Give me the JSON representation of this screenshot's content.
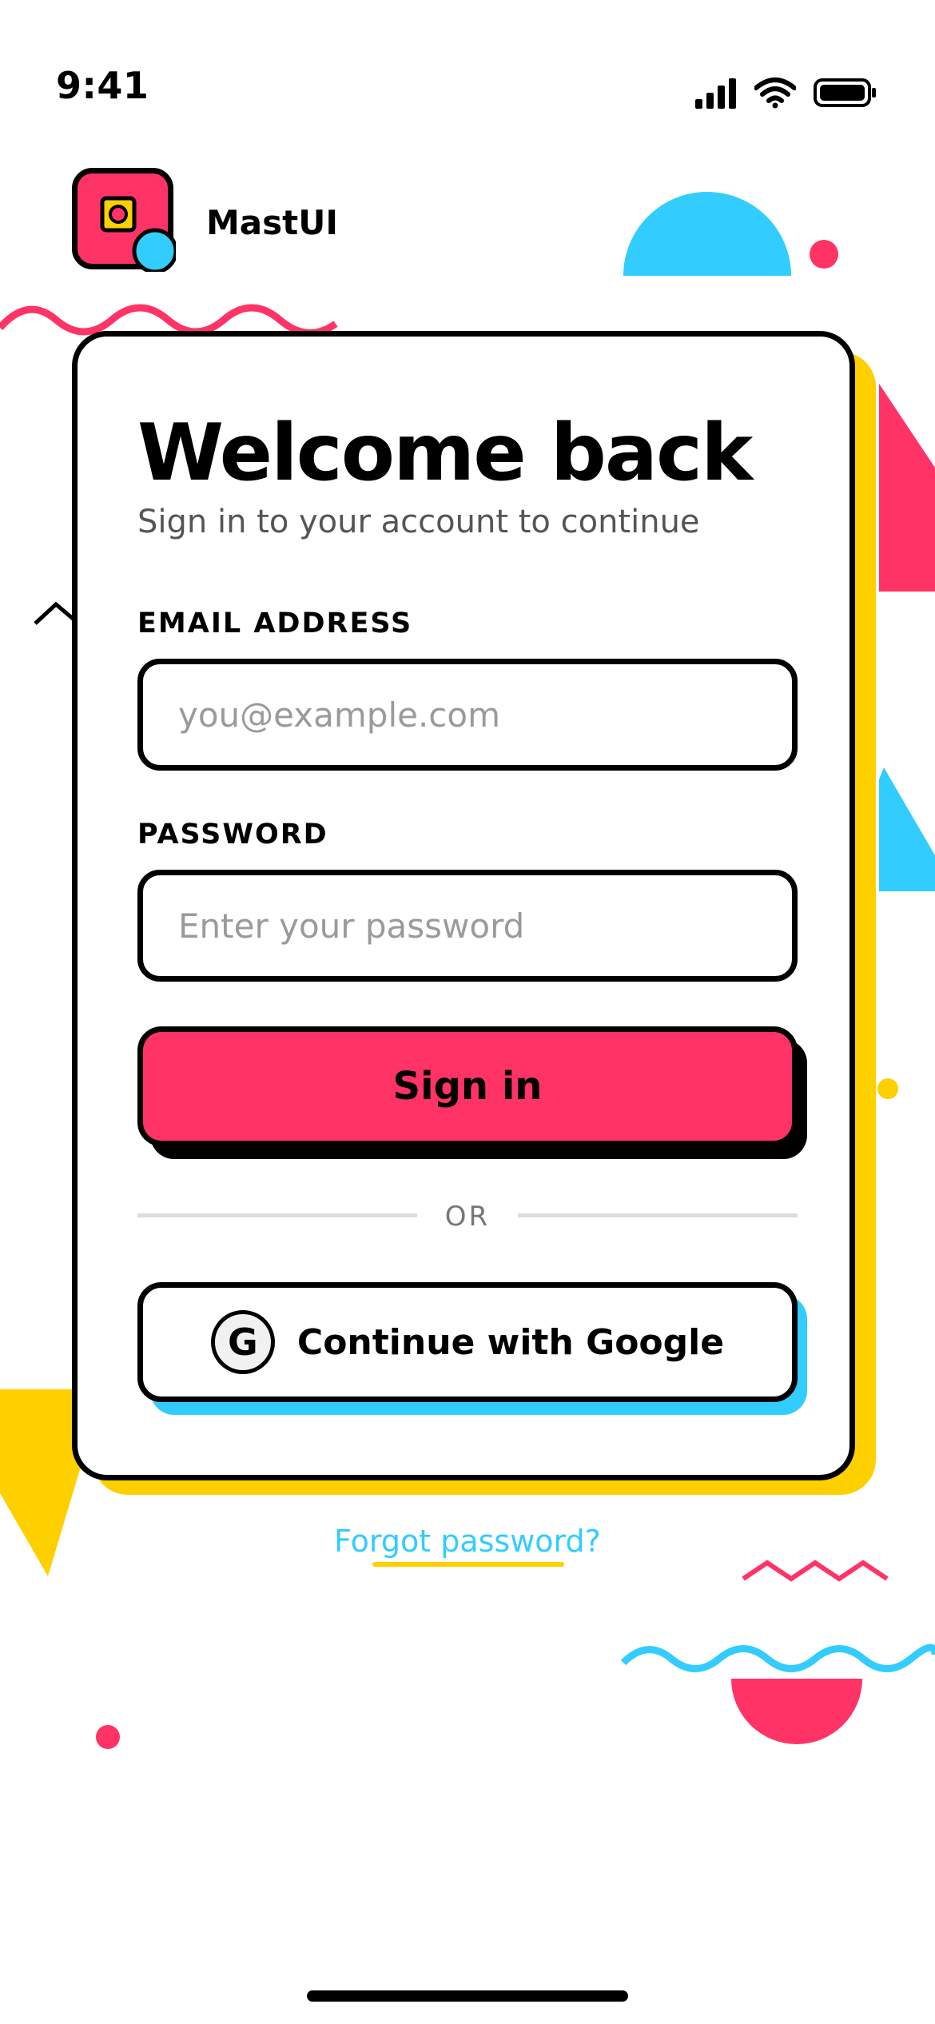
{
  "status_bar": {
    "time": "9:41",
    "icons": [
      "signal-icon",
      "wifi-icon",
      "battery-icon"
    ]
  },
  "brand": {
    "name": "MastUI"
  },
  "login": {
    "title": "Welcome back",
    "subtitle": "Sign in to your account to continue",
    "email_label": "EMAIL ADDRESS",
    "email_placeholder": "you@example.com",
    "email_value": "",
    "password_label": "PASSWORD",
    "password_placeholder": "Enter your password",
    "password_value": "",
    "signin_label": "Sign in",
    "divider_text": "OR",
    "google_label": "Continue with Google",
    "google_icon_letter": "G",
    "forgot_label": "Forgot password?"
  },
  "colors": {
    "pink": "#ff3366",
    "blue": "#33ccff",
    "yellow": "#ffd000",
    "black": "#000000"
  }
}
